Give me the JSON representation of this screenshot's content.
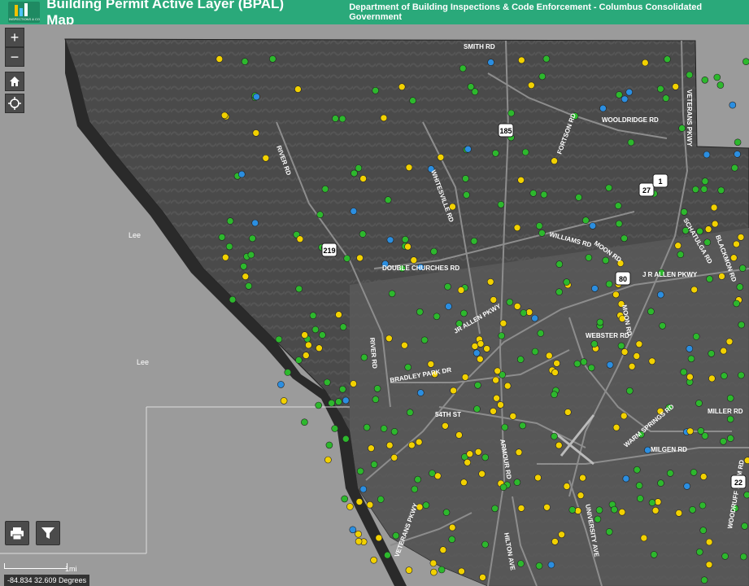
{
  "header": {
    "title": "Building Permit Active Layer (BPAL) Map",
    "department": "Department of Building Inspections & Code Enforcement - Columbus Consolidated Government",
    "logo_text": "INSPECTIONS & CODE"
  },
  "controls": {
    "zoom_in": "+",
    "zoom_out": "−"
  },
  "map": {
    "area_labels": [
      "Lee",
      "Lee"
    ],
    "road_labels": [
      {
        "text": "SMITH RD"
      },
      {
        "text": "RIVER RD"
      },
      {
        "text": "WHITESVILLE RD"
      },
      {
        "text": "FORTSON RD"
      },
      {
        "text": "VETERANS PKWY"
      },
      {
        "text": "WOOLDRIDGE RD"
      },
      {
        "text": "DOUBLE CHURCHES RD"
      },
      {
        "text": "WILLIAMS RD"
      },
      {
        "text": "MOON RD"
      },
      {
        "text": "SCHATULGA RD"
      },
      {
        "text": "BLACKMON RD"
      },
      {
        "text": "J R ALLEN PKWY"
      },
      {
        "text": "JR ALLEN PKWY"
      },
      {
        "text": "MOON RD"
      },
      {
        "text": "WEBSTER RD"
      },
      {
        "text": "RIVER RD"
      },
      {
        "text": "BRADLEY PARK DR"
      },
      {
        "text": "MILLER RD"
      },
      {
        "text": "ARMOUR RD"
      },
      {
        "text": "WARM SPRINGS RD"
      },
      {
        "text": "MILGEN RD"
      },
      {
        "text": "UNIVERSITY AVE"
      },
      {
        "text": "HILTON AVE"
      },
      {
        "text": "VETERANS PKWY"
      },
      {
        "text": "WOODRUFF FARM RD"
      },
      {
        "text": "54TH ST"
      }
    ],
    "shields": [
      "185",
      "27",
      "1",
      "219",
      "80",
      "22"
    ],
    "colors": {
      "permit_green": "#2db82d",
      "permit_yellow": "#f2d100",
      "permit_blue": "#2b8ee0",
      "county_bg": "#4a4a4a",
      "outside_bg": "#9b9b9b",
      "river": "#2a2a2a"
    }
  },
  "tools": {
    "print_icon": "print-icon",
    "filter_icon": "filter-icon"
  },
  "scale_label": "1mi",
  "coordinates": "-84.834 32.609 Degrees"
}
